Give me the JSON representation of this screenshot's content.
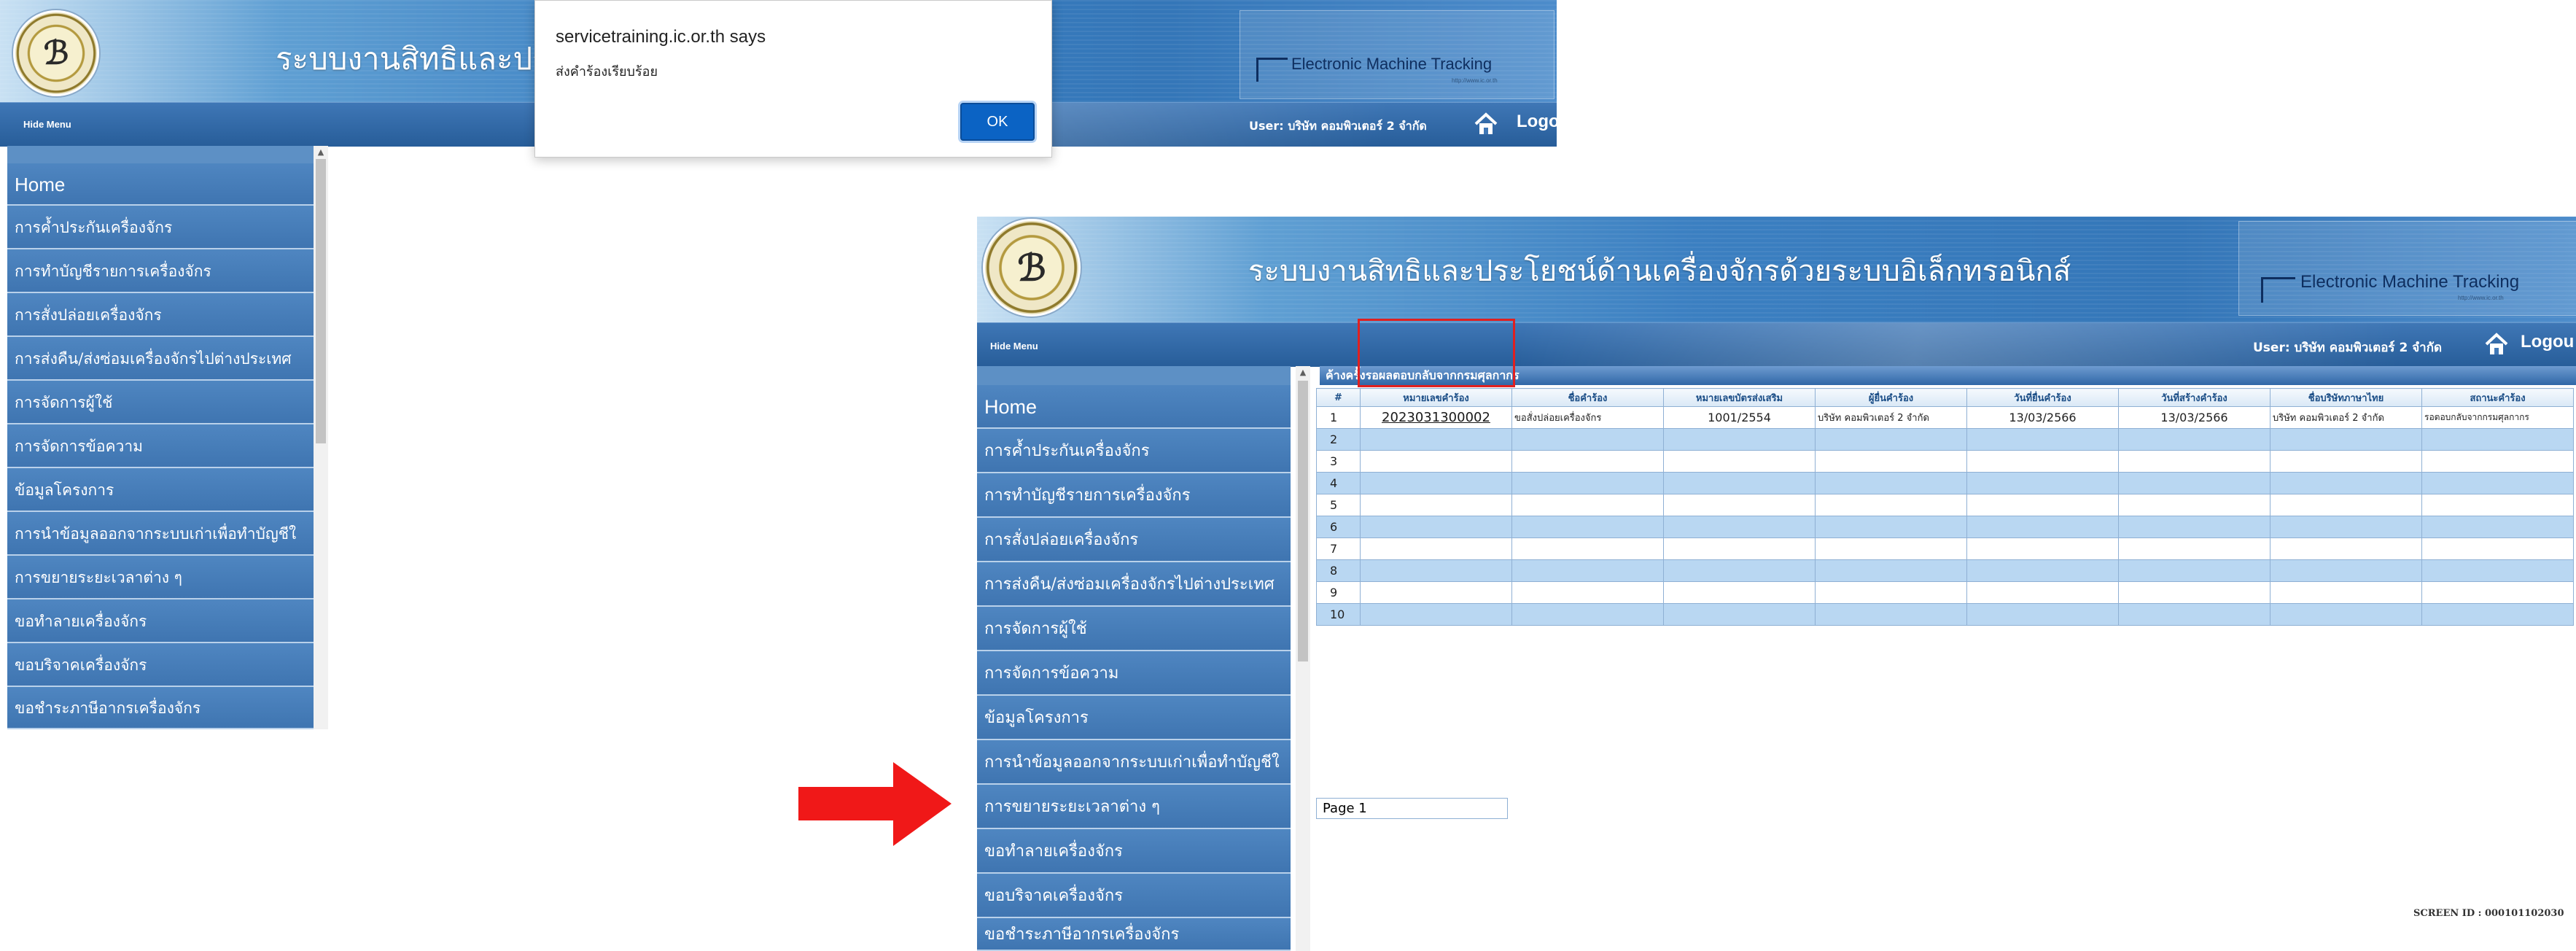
{
  "header": {
    "system_title_partial": "ระบบงานสิทธิและประโยช",
    "system_title": "ระบบงานสิทธิและประโยชน์ด้านเครื่องจักรด้วยระบบอิเล็กทรอนิกส์",
    "emt_title": "Electronic Machine Tracking",
    "emt_url": "http://www.ic.or.th"
  },
  "toolbar": {
    "hide_menu": "Hide Menu",
    "user": "User: บริษัท คอมพิวเตอร์ 2 จำกัด",
    "logout_partial_1": "Logo",
    "logout_partial_2": "Logou",
    "home_icon": "home-icon"
  },
  "dialog": {
    "title": "servicetraining.ic.or.th says",
    "message": "ส่งคำร้องเรียบร้อย",
    "ok_label": "OK"
  },
  "sidebar": {
    "items": [
      {
        "label": "Home"
      },
      {
        "label": "การค้ำประกันเครื่องจักร"
      },
      {
        "label": "การทำบัญชีรายการเครื่องจักร"
      },
      {
        "label": "การสั่งปล่อยเครื่องจักร"
      },
      {
        "label": "การส่งคืน/ส่งซ่อมเครื่องจักรไปต่างประเทศ"
      },
      {
        "label": "การจัดการผู้ใช้"
      },
      {
        "label": "การจัดการข้อความ"
      },
      {
        "label": "ข้อมูลโครงการ"
      },
      {
        "label": "การนำข้อมูลออกจากระบบเก่าเพื่อทำบัญชีใ"
      },
      {
        "label": "การขยายระยะเวลาต่าง ๆ"
      },
      {
        "label": "ขอทำลายเครื่องจักร"
      },
      {
        "label": "ขอบริจาคเครื่องจักร"
      },
      {
        "label": "ขอชำระภาษีอากรเครื่องจักร"
      }
    ]
  },
  "panel": {
    "title": "ค้างครั้งรอผลตอบกลับจากกรมศุลกากร",
    "columns": [
      "#",
      "หมายเลขคำร้อง",
      "ชื่อคำร้อง",
      "หมายเลขบัตรส่งเสริม",
      "ผู้ยื่นคำร้อง",
      "วันที่ยื่นคำร้อง",
      "วันที่สร้างคำร้อง",
      "ชื่อบริษัทภาษาไทย",
      "สถานะคำร้อง"
    ],
    "rows": [
      {
        "no": "1",
        "req_no": "2023031300002",
        "req_name": "ขอสั่งปล่อยเครื่องจักร",
        "promo_no": "1001/2554",
        "applicant": "บริษัท คอมพิวเตอร์ 2 จำกัด",
        "submit_date": "13/03/2566",
        "create_date": "13/03/2566",
        "company_th": "บริษัท คอมพิวเตอร์ 2 จำกัด",
        "status": "รอตอบกลับจากกรมศุลกากร"
      },
      {
        "no": "2"
      },
      {
        "no": "3"
      },
      {
        "no": "4"
      },
      {
        "no": "5"
      },
      {
        "no": "6"
      },
      {
        "no": "7"
      },
      {
        "no": "8"
      },
      {
        "no": "9"
      },
      {
        "no": "10"
      }
    ],
    "page": "Page 1",
    "screen_id": "SCREEN ID : 000101102030"
  },
  "colors": {
    "header_blue": "#3476b8",
    "menu_blue": "#4f86c1",
    "row_blue": "#b9d7f2",
    "ok_blue": "#0b63c4",
    "highlight_red": "#e02020",
    "arrow_red": "#f01818"
  }
}
